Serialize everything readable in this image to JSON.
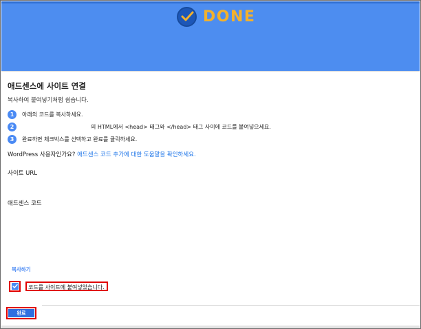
{
  "header": {
    "done_label": "DONE",
    "icon": "check-circle-icon",
    "banner_color": "#4d8df0",
    "done_color": "#f3b12c"
  },
  "card": {
    "title": "애드센스에 사이트 연결",
    "subtitle": "복사하여 붙여넣기처럼 쉽습니다.",
    "steps": [
      {
        "number": "1",
        "text": "아래의 코드를 복사하세요."
      },
      {
        "number": "2",
        "text": "의 HTML에서 <head> 태그와 </head> 태그 사이에 코드를 붙여넣으세요."
      },
      {
        "number": "3",
        "text": "완료하면 체크박스를 선택하고 완료를 클릭하세요."
      }
    ],
    "wordpress_prefix": "WordPress 사용자인가요?",
    "wordpress_link": "애드센스 코드 추가에 대한 도움말을 확인하세요.",
    "site_url_label": "사이트 URL",
    "adsense_code_label": "애드센스 코드",
    "copy_label": "복사하기",
    "confirm_checkbox_label": "코드를 사이트에 붙여넣었습니다.",
    "finish_button": "완료",
    "accent_color": "#4a8af4",
    "highlight_color": "#e00000"
  }
}
